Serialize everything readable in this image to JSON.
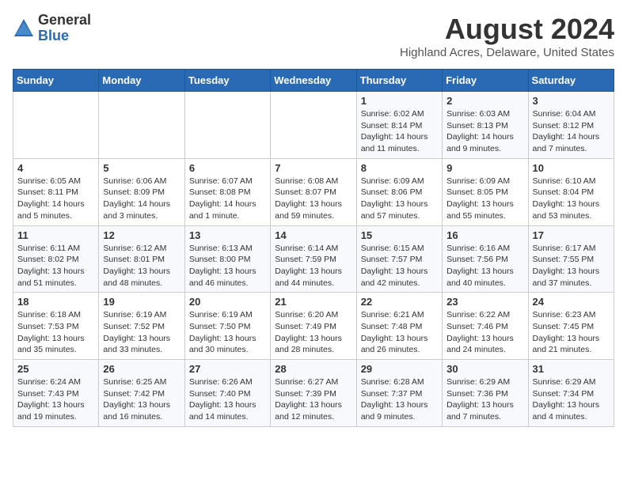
{
  "logo": {
    "general": "General",
    "blue": "Blue"
  },
  "title": "August 2024",
  "subtitle": "Highland Acres, Delaware, United States",
  "days_of_week": [
    "Sunday",
    "Monday",
    "Tuesday",
    "Wednesday",
    "Thursday",
    "Friday",
    "Saturday"
  ],
  "weeks": [
    [
      {
        "day": "",
        "info": ""
      },
      {
        "day": "",
        "info": ""
      },
      {
        "day": "",
        "info": ""
      },
      {
        "day": "",
        "info": ""
      },
      {
        "day": "1",
        "info": "Sunrise: 6:02 AM\nSunset: 8:14 PM\nDaylight: 14 hours\nand 11 minutes."
      },
      {
        "day": "2",
        "info": "Sunrise: 6:03 AM\nSunset: 8:13 PM\nDaylight: 14 hours\nand 9 minutes."
      },
      {
        "day": "3",
        "info": "Sunrise: 6:04 AM\nSunset: 8:12 PM\nDaylight: 14 hours\nand 7 minutes."
      }
    ],
    [
      {
        "day": "4",
        "info": "Sunrise: 6:05 AM\nSunset: 8:11 PM\nDaylight: 14 hours\nand 5 minutes."
      },
      {
        "day": "5",
        "info": "Sunrise: 6:06 AM\nSunset: 8:09 PM\nDaylight: 14 hours\nand 3 minutes."
      },
      {
        "day": "6",
        "info": "Sunrise: 6:07 AM\nSunset: 8:08 PM\nDaylight: 14 hours\nand 1 minute."
      },
      {
        "day": "7",
        "info": "Sunrise: 6:08 AM\nSunset: 8:07 PM\nDaylight: 13 hours\nand 59 minutes."
      },
      {
        "day": "8",
        "info": "Sunrise: 6:09 AM\nSunset: 8:06 PM\nDaylight: 13 hours\nand 57 minutes."
      },
      {
        "day": "9",
        "info": "Sunrise: 6:09 AM\nSunset: 8:05 PM\nDaylight: 13 hours\nand 55 minutes."
      },
      {
        "day": "10",
        "info": "Sunrise: 6:10 AM\nSunset: 8:04 PM\nDaylight: 13 hours\nand 53 minutes."
      }
    ],
    [
      {
        "day": "11",
        "info": "Sunrise: 6:11 AM\nSunset: 8:02 PM\nDaylight: 13 hours\nand 51 minutes."
      },
      {
        "day": "12",
        "info": "Sunrise: 6:12 AM\nSunset: 8:01 PM\nDaylight: 13 hours\nand 48 minutes."
      },
      {
        "day": "13",
        "info": "Sunrise: 6:13 AM\nSunset: 8:00 PM\nDaylight: 13 hours\nand 46 minutes."
      },
      {
        "day": "14",
        "info": "Sunrise: 6:14 AM\nSunset: 7:59 PM\nDaylight: 13 hours\nand 44 minutes."
      },
      {
        "day": "15",
        "info": "Sunrise: 6:15 AM\nSunset: 7:57 PM\nDaylight: 13 hours\nand 42 minutes."
      },
      {
        "day": "16",
        "info": "Sunrise: 6:16 AM\nSunset: 7:56 PM\nDaylight: 13 hours\nand 40 minutes."
      },
      {
        "day": "17",
        "info": "Sunrise: 6:17 AM\nSunset: 7:55 PM\nDaylight: 13 hours\nand 37 minutes."
      }
    ],
    [
      {
        "day": "18",
        "info": "Sunrise: 6:18 AM\nSunset: 7:53 PM\nDaylight: 13 hours\nand 35 minutes."
      },
      {
        "day": "19",
        "info": "Sunrise: 6:19 AM\nSunset: 7:52 PM\nDaylight: 13 hours\nand 33 minutes."
      },
      {
        "day": "20",
        "info": "Sunrise: 6:19 AM\nSunset: 7:50 PM\nDaylight: 13 hours\nand 30 minutes."
      },
      {
        "day": "21",
        "info": "Sunrise: 6:20 AM\nSunset: 7:49 PM\nDaylight: 13 hours\nand 28 minutes."
      },
      {
        "day": "22",
        "info": "Sunrise: 6:21 AM\nSunset: 7:48 PM\nDaylight: 13 hours\nand 26 minutes."
      },
      {
        "day": "23",
        "info": "Sunrise: 6:22 AM\nSunset: 7:46 PM\nDaylight: 13 hours\nand 24 minutes."
      },
      {
        "day": "24",
        "info": "Sunrise: 6:23 AM\nSunset: 7:45 PM\nDaylight: 13 hours\nand 21 minutes."
      }
    ],
    [
      {
        "day": "25",
        "info": "Sunrise: 6:24 AM\nSunset: 7:43 PM\nDaylight: 13 hours\nand 19 minutes."
      },
      {
        "day": "26",
        "info": "Sunrise: 6:25 AM\nSunset: 7:42 PM\nDaylight: 13 hours\nand 16 minutes."
      },
      {
        "day": "27",
        "info": "Sunrise: 6:26 AM\nSunset: 7:40 PM\nDaylight: 13 hours\nand 14 minutes."
      },
      {
        "day": "28",
        "info": "Sunrise: 6:27 AM\nSunset: 7:39 PM\nDaylight: 13 hours\nand 12 minutes."
      },
      {
        "day": "29",
        "info": "Sunrise: 6:28 AM\nSunset: 7:37 PM\nDaylight: 13 hours\nand 9 minutes."
      },
      {
        "day": "30",
        "info": "Sunrise: 6:29 AM\nSunset: 7:36 PM\nDaylight: 13 hours\nand 7 minutes."
      },
      {
        "day": "31",
        "info": "Sunrise: 6:29 AM\nSunset: 7:34 PM\nDaylight: 13 hours\nand 4 minutes."
      }
    ]
  ]
}
